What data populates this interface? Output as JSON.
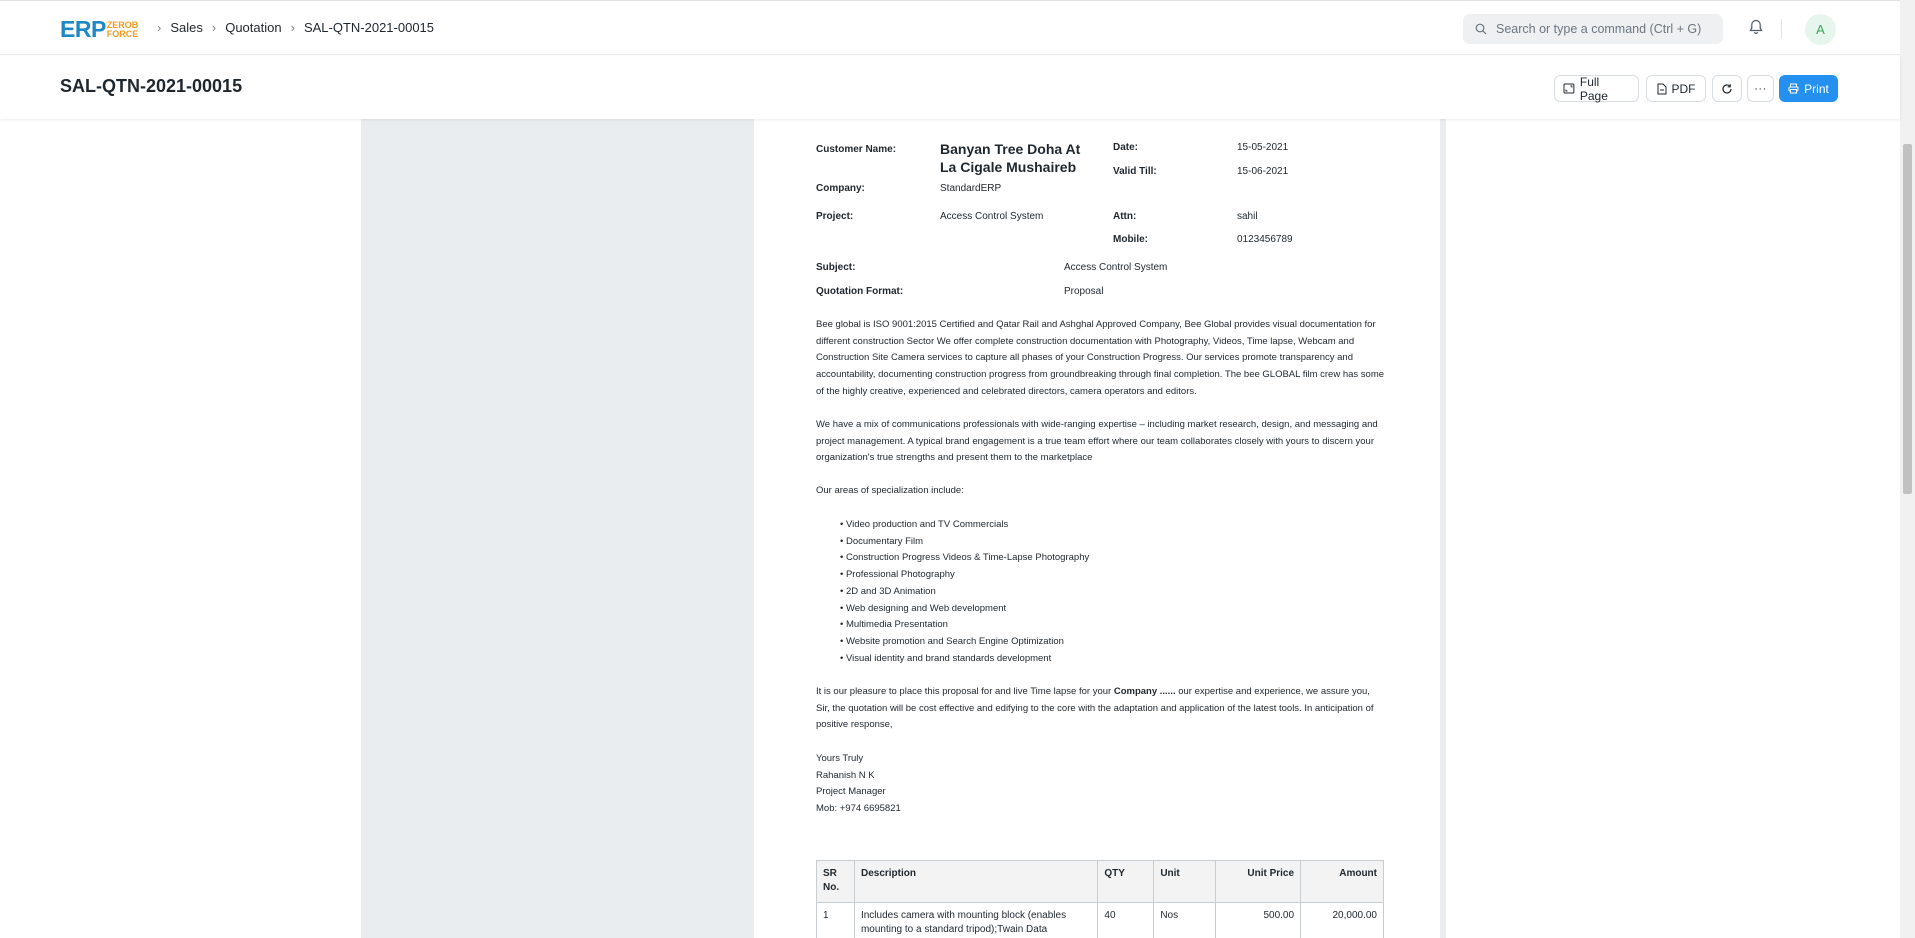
{
  "navbar": {
    "logo": {
      "main": "ERP",
      "sub_top": "ZEROB",
      "sub_bottom": "FORCE"
    },
    "breadcrumbs": [
      "Sales",
      "Quotation",
      "SAL-QTN-2021-00015"
    ],
    "search_placeholder": "Search or type a command (Ctrl + G)",
    "avatar_initial": "A"
  },
  "page": {
    "title": "SAL-QTN-2021-00015",
    "actions": {
      "full_page": "Full Page",
      "pdf": "PDF",
      "print": "Print"
    }
  },
  "doc": {
    "customer_label": "Customer Name:",
    "customer_value": "Banyan Tree Doha At La Cigale Mushaireb",
    "date_label": "Date:",
    "date_value": "15-05-2021",
    "valid_label": "Valid Till:",
    "valid_value": "15-06-2021",
    "company_label": "Company:",
    "company_value": "StandardERP",
    "project_label": "Project:",
    "project_value": "Access Control System",
    "attn_label": "Attn:",
    "attn_value": "sahil",
    "mobile_label": "Mobile:",
    "mobile_value": "0123456789",
    "subject_label": "Subject:",
    "subject_value": "Access Control System",
    "format_label": "Quotation Format:",
    "format_value": "Proposal",
    "para1": "Bee global is ISO 9001:2015 Certified and Qatar Rail and Ashghal Approved Company, Bee Global provides visual documentation for different construction Sector We offer complete construction documentation with Photography, Videos, Time lapse, Webcam and Construction Site Camera services to capture all phases of your Construction Progress. Our services promote transparency and accountability, documenting construction progress from groundbreaking through final completion. The bee GLOBAL film crew has some of the highly creative, experienced and celebrated directors, camera operators and editors.",
    "para2": "We have a mix of communications professionals with wide-ranging expertise – including market research, design, and messaging and project management. A typical brand engagement is a true team effort where our team collaborates closely with yours to discern your organization's true strengths and present them to the marketplace",
    "para3": "Our areas of specialization include:",
    "bullets": [
      "Video production and TV Commercials",
      "Documentary Film",
      "Construction Progress Videos & Time-Lapse Photography",
      "Professional Photography",
      "2D and 3D Animation",
      "Web designing and Web development",
      "Multimedia Presentation",
      "Website promotion and Search Engine Optimization",
      "Visual identity and brand standards development"
    ],
    "para4_a": "It is our pleasure to place this proposal for and live Time lapse for your ",
    "para4_bold": "Company ......",
    "para4_b": " our expertise and experience, we assure you, Sir, the quotation will be cost effective and edifying to the core with the adaptation and application of the latest tools. In anticipation of positive response,",
    "signoff": [
      "Yours Truly",
      "Rahanish N K",
      "Project Manager",
      "Mob: +974 6695821"
    ],
    "table": {
      "headers": [
        "SR No.",
        "Description",
        "QTY",
        "Unit",
        "Unit Price",
        "Amount"
      ],
      "rows": [
        [
          "1",
          "Includes camera with mounting block (enables mounting to a standard tripod);Twain Data",
          "40",
          "Nos",
          "500.00",
          "20,000.00"
        ]
      ]
    }
  },
  "colors": {
    "primary": "#2490ef",
    "logo_blue": "#1e88c7",
    "logo_orange": "#f29b1f"
  }
}
